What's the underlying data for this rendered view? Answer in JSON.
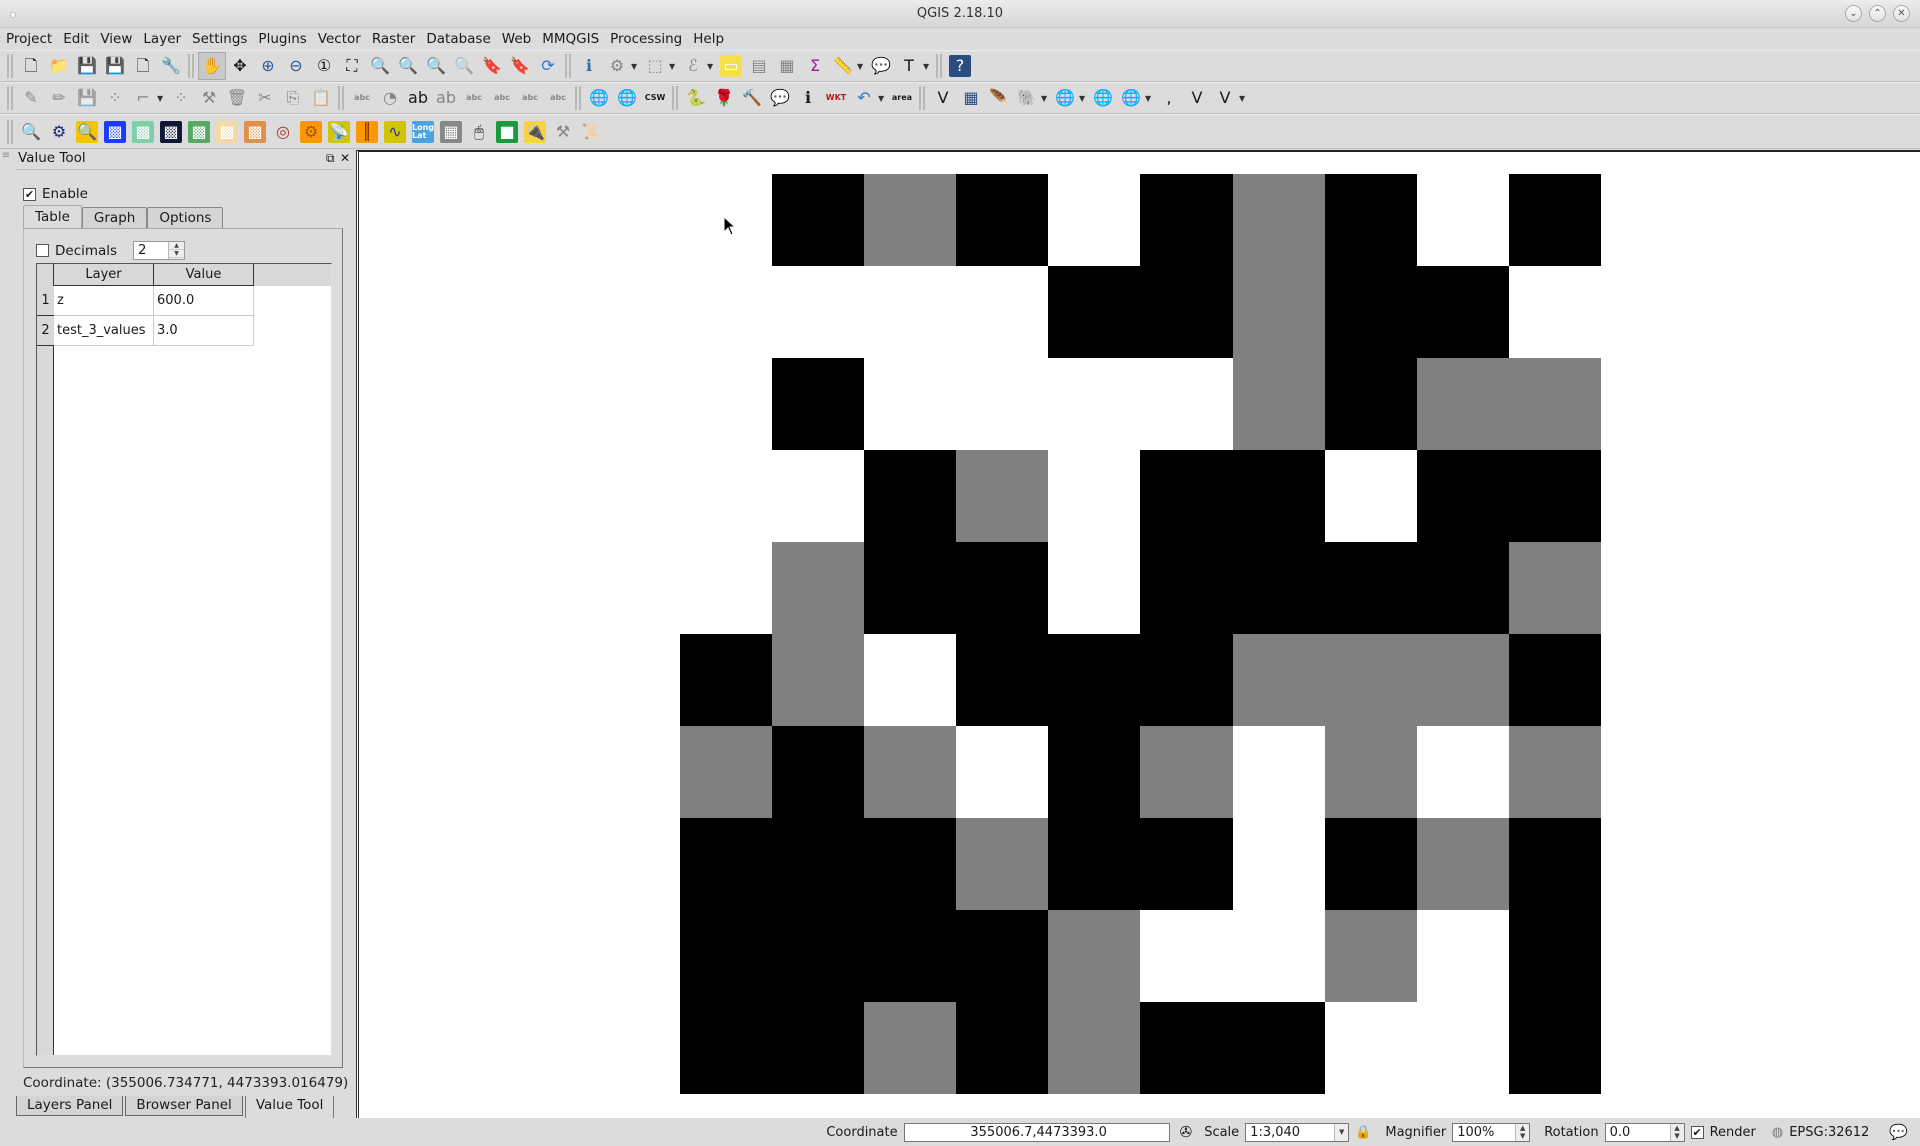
{
  "window": {
    "title": "QGIS 2.18.10",
    "controls": [
      "minimize",
      "maximize",
      "close"
    ]
  },
  "menubar": [
    "Project",
    "Edit",
    "View",
    "Layer",
    "Settings",
    "Plugins",
    "Vector",
    "Raster",
    "Database",
    "Web",
    "MMQGIS",
    "Processing",
    "Help"
  ],
  "toolbars": {
    "row1": [
      {
        "name": "new-project-icon",
        "glyph": "🗋"
      },
      {
        "name": "open-project-icon",
        "glyph": "📁"
      },
      {
        "name": "save-project-icon",
        "glyph": "💾"
      },
      {
        "name": "save-as-icon",
        "glyph": "💾"
      },
      {
        "name": "new-print-composer-icon",
        "glyph": "🗋"
      },
      {
        "name": "composer-manager-icon",
        "glyph": "🔧"
      },
      {
        "sep": true
      },
      {
        "name": "pan-icon",
        "glyph": "✋",
        "active": true
      },
      {
        "name": "pan-to-selection-icon",
        "glyph": "✥"
      },
      {
        "name": "zoom-in-icon",
        "glyph": "⊕"
      },
      {
        "name": "zoom-out-icon",
        "glyph": "⊖"
      },
      {
        "name": "zoom-native-icon",
        "glyph": "①"
      },
      {
        "name": "zoom-full-icon",
        "glyph": "⛶"
      },
      {
        "name": "zoom-to-selection-icon",
        "glyph": "🔍"
      },
      {
        "name": "zoom-to-layer-icon",
        "glyph": "🔍"
      },
      {
        "name": "zoom-last-icon",
        "glyph": "🔍"
      },
      {
        "name": "zoom-next-icon",
        "glyph": "🔍",
        "disabled": true
      },
      {
        "name": "new-bookmark-icon",
        "glyph": "🔖"
      },
      {
        "name": "show-bookmarks-icon",
        "glyph": "🔖"
      },
      {
        "name": "refresh-icon",
        "glyph": "⟳"
      },
      {
        "sep": true
      },
      {
        "name": "identify-icon",
        "glyph": "ℹ"
      },
      {
        "name": "run-action-icon",
        "glyph": "⚙",
        "dropdown": true,
        "disabled": true
      },
      {
        "name": "select-features-icon",
        "glyph": "⬚",
        "dropdown": true,
        "disabled": true
      },
      {
        "name": "select-by-expression-icon",
        "glyph": "ℰ",
        "dropdown": true,
        "disabled": true
      },
      {
        "name": "deselect-all-icon",
        "glyph": "▭"
      },
      {
        "name": "attribute-table-icon",
        "glyph": "▤",
        "disabled": true
      },
      {
        "name": "field-calculator-icon",
        "glyph": "▦",
        "disabled": true
      },
      {
        "name": "statistical-summary-icon",
        "glyph": "Σ"
      },
      {
        "name": "measure-icon",
        "glyph": "📏",
        "dropdown": true
      },
      {
        "name": "map-tips-icon",
        "glyph": "💬"
      },
      {
        "name": "text-annotation-icon",
        "glyph": "T",
        "dropdown": true
      },
      {
        "sep": true
      },
      {
        "name": "help-icon",
        "glyph": "?"
      }
    ],
    "row2": [
      {
        "name": "current-edits-icon",
        "glyph": "✎",
        "disabled": true
      },
      {
        "name": "toggle-editing-icon",
        "glyph": "✏",
        "disabled": true
      },
      {
        "name": "save-edits-icon",
        "glyph": "💾",
        "disabled": true
      },
      {
        "name": "add-point-icon",
        "glyph": "⁘",
        "disabled": true
      },
      {
        "name": "node-tool-icon",
        "glyph": "⌐",
        "dropdown": true,
        "disabled": true
      },
      {
        "name": "move-feature-icon",
        "glyph": "⁘",
        "disabled": true
      },
      {
        "name": "edit-tool-icon",
        "glyph": "⚒",
        "disabled": true
      },
      {
        "name": "delete-selected-icon",
        "glyph": "🗑",
        "disabled": true
      },
      {
        "name": "cut-features-icon",
        "glyph": "✂",
        "disabled": true
      },
      {
        "name": "copy-features-icon",
        "glyph": "⎘",
        "disabled": true
      },
      {
        "name": "paste-features-icon",
        "glyph": "📋",
        "disabled": true
      },
      {
        "sep": true
      },
      {
        "name": "layer-labeling-icon",
        "glyph": "abc",
        "disabled": true
      },
      {
        "name": "diagram-options-icon",
        "glyph": "◔",
        "disabled": true
      },
      {
        "name": "pin-labels-icon",
        "glyph": "ab"
      },
      {
        "name": "highlight-pinned-labels-icon",
        "glyph": "ab",
        "disabled": true
      },
      {
        "name": "show-hide-labels-icon",
        "glyph": "abc",
        "disabled": true
      },
      {
        "name": "move-label-icon",
        "glyph": "abc",
        "disabled": true
      },
      {
        "name": "rotate-label-icon",
        "glyph": "abc",
        "disabled": true
      },
      {
        "name": "change-label-icon",
        "glyph": "abc",
        "disabled": true
      },
      {
        "sep": true
      },
      {
        "name": "add-wms-icon",
        "glyph": "🌐"
      },
      {
        "name": "metasearch-icon",
        "glyph": "🌐"
      },
      {
        "name": "csw-icon",
        "glyph": "CSW"
      },
      {
        "sep": true
      },
      {
        "name": "python-console-icon",
        "glyph": "🐍"
      },
      {
        "name": "plugin-icon",
        "glyph": "🌹"
      },
      {
        "name": "plugin-builder-icon",
        "glyph": "🔨"
      },
      {
        "name": "annotation-icon",
        "glyph": "💬"
      },
      {
        "name": "identify-plugin-icon",
        "glyph": "ℹ"
      },
      {
        "name": "wkt-icon",
        "glyph": "WKT"
      },
      {
        "name": "undo-icon",
        "glyph": "↶",
        "dropdown": true
      },
      {
        "name": "area-icon",
        "glyph": "area"
      },
      {
        "sep": true
      },
      {
        "name": "add-vector-layer-icon",
        "glyph": "V"
      },
      {
        "name": "add-raster-layer-icon",
        "glyph": "▦"
      },
      {
        "name": "add-spatialite-layer-icon",
        "glyph": "🪶"
      },
      {
        "name": "add-postgis-layer-icon",
        "glyph": "🐘",
        "dropdown": true
      },
      {
        "name": "add-wms-layer-icon",
        "glyph": "🌐",
        "dropdown": true
      },
      {
        "name": "add-wcs-layer-icon",
        "glyph": "🌐"
      },
      {
        "name": "add-wfs-layer-icon",
        "glyph": "🌐",
        "dropdown": true
      },
      {
        "name": "add-delimited-text-icon",
        "glyph": ","
      },
      {
        "name": "add-virtual-layer-icon",
        "glyph": "V"
      },
      {
        "name": "new-shapefile-icon",
        "glyph": "V",
        "dropdown": true
      }
    ],
    "row3": [
      {
        "name": "geo-search-icon",
        "glyph": "🔍"
      },
      {
        "name": "processing-gear-icon",
        "glyph": "⚙"
      },
      {
        "name": "search-plugin-icon",
        "glyph": "🔍"
      },
      {
        "name": "network-plugin-icon",
        "glyph": "▩"
      },
      {
        "name": "raster-plugin-icon",
        "glyph": "▩"
      },
      {
        "name": "image-plugin-icon",
        "glyph": "▩"
      },
      {
        "name": "grid-plugin-icon",
        "glyph": "▩"
      },
      {
        "name": "heatmap-plugin-icon",
        "glyph": "▩"
      },
      {
        "name": "random-raster-plugin-icon",
        "glyph": "▩"
      },
      {
        "name": "spiral-plugin-icon",
        "glyph": "◎"
      },
      {
        "name": "gears-plugin-icon",
        "glyph": "⚙"
      },
      {
        "name": "satellite-plugin-icon",
        "glyph": "📡"
      },
      {
        "name": "value-tool-icon",
        "glyph": "║"
      },
      {
        "name": "profile-tool-icon",
        "glyph": "∿"
      },
      {
        "name": "lat-long-tool-icon",
        "glyph": "Long Lat"
      },
      {
        "name": "georeferencer-icon",
        "glyph": "▦"
      },
      {
        "name": "coordinate-capture-icon",
        "glyph": "🖱"
      },
      {
        "name": "raster-calc-icon",
        "glyph": "■"
      },
      {
        "name": "plugin-loader-icon",
        "glyph": "🔌"
      },
      {
        "name": "map-tools-icon",
        "glyph": "⚒",
        "disabled": true
      },
      {
        "name": "print-icon",
        "glyph": "📜",
        "disabled": true
      }
    ]
  },
  "dock": {
    "title": "Value Tool",
    "enable_label": "Enable",
    "enable_checked": true,
    "tabs": [
      {
        "label": "Table",
        "selected": true
      },
      {
        "label": "Graph",
        "selected": false
      },
      {
        "label": "Options",
        "selected": false
      }
    ],
    "decimals_label": "Decimals",
    "decimals_checked": false,
    "decimals_value": "2",
    "table": {
      "columns": [
        "Layer",
        "Value"
      ],
      "rows": [
        {
          "num": "1",
          "layer": "z",
          "value": "600.0"
        },
        {
          "num": "2",
          "layer": "test_3_values",
          "value": "3.0"
        }
      ]
    },
    "coordinate": "Coordinate: (355006.734771, 4473393.016479)",
    "bottom_tabs": [
      {
        "label": "Layers Panel",
        "selected": false
      },
      {
        "label": "Browser Panel",
        "selected": false
      },
      {
        "label": "Value Tool",
        "selected": true
      }
    ]
  },
  "map": {
    "layer": "test_3_values",
    "colors": {
      "B": "#000000",
      "G": "#808080",
      "W": "#ffffff"
    },
    "grid": [
      "WBGBWBGBWB",
      "WWWWBBGBBW",
      "WBWWWWGBGG",
      "WWBGWBBWBB",
      "WGBBWBBBBG",
      "BGWBBBGGGB",
      "GBGWBGWGWG",
      "BBBGBBWBGB",
      "BBBBGWWGWB",
      "BBGBGBBWWB"
    ]
  },
  "statusbar": {
    "coordinate_label": "Coordinate",
    "coordinate_value": "355006.7,4473393.0",
    "scale_label": "Scale",
    "scale_value": "1:3,040",
    "magnifier_label": "Magnifier",
    "magnifier_value": "100%",
    "rotation_label": "Rotation",
    "rotation_value": "0.0",
    "render_label": "Render",
    "render_checked": true,
    "crs": "EPSG:32612"
  }
}
